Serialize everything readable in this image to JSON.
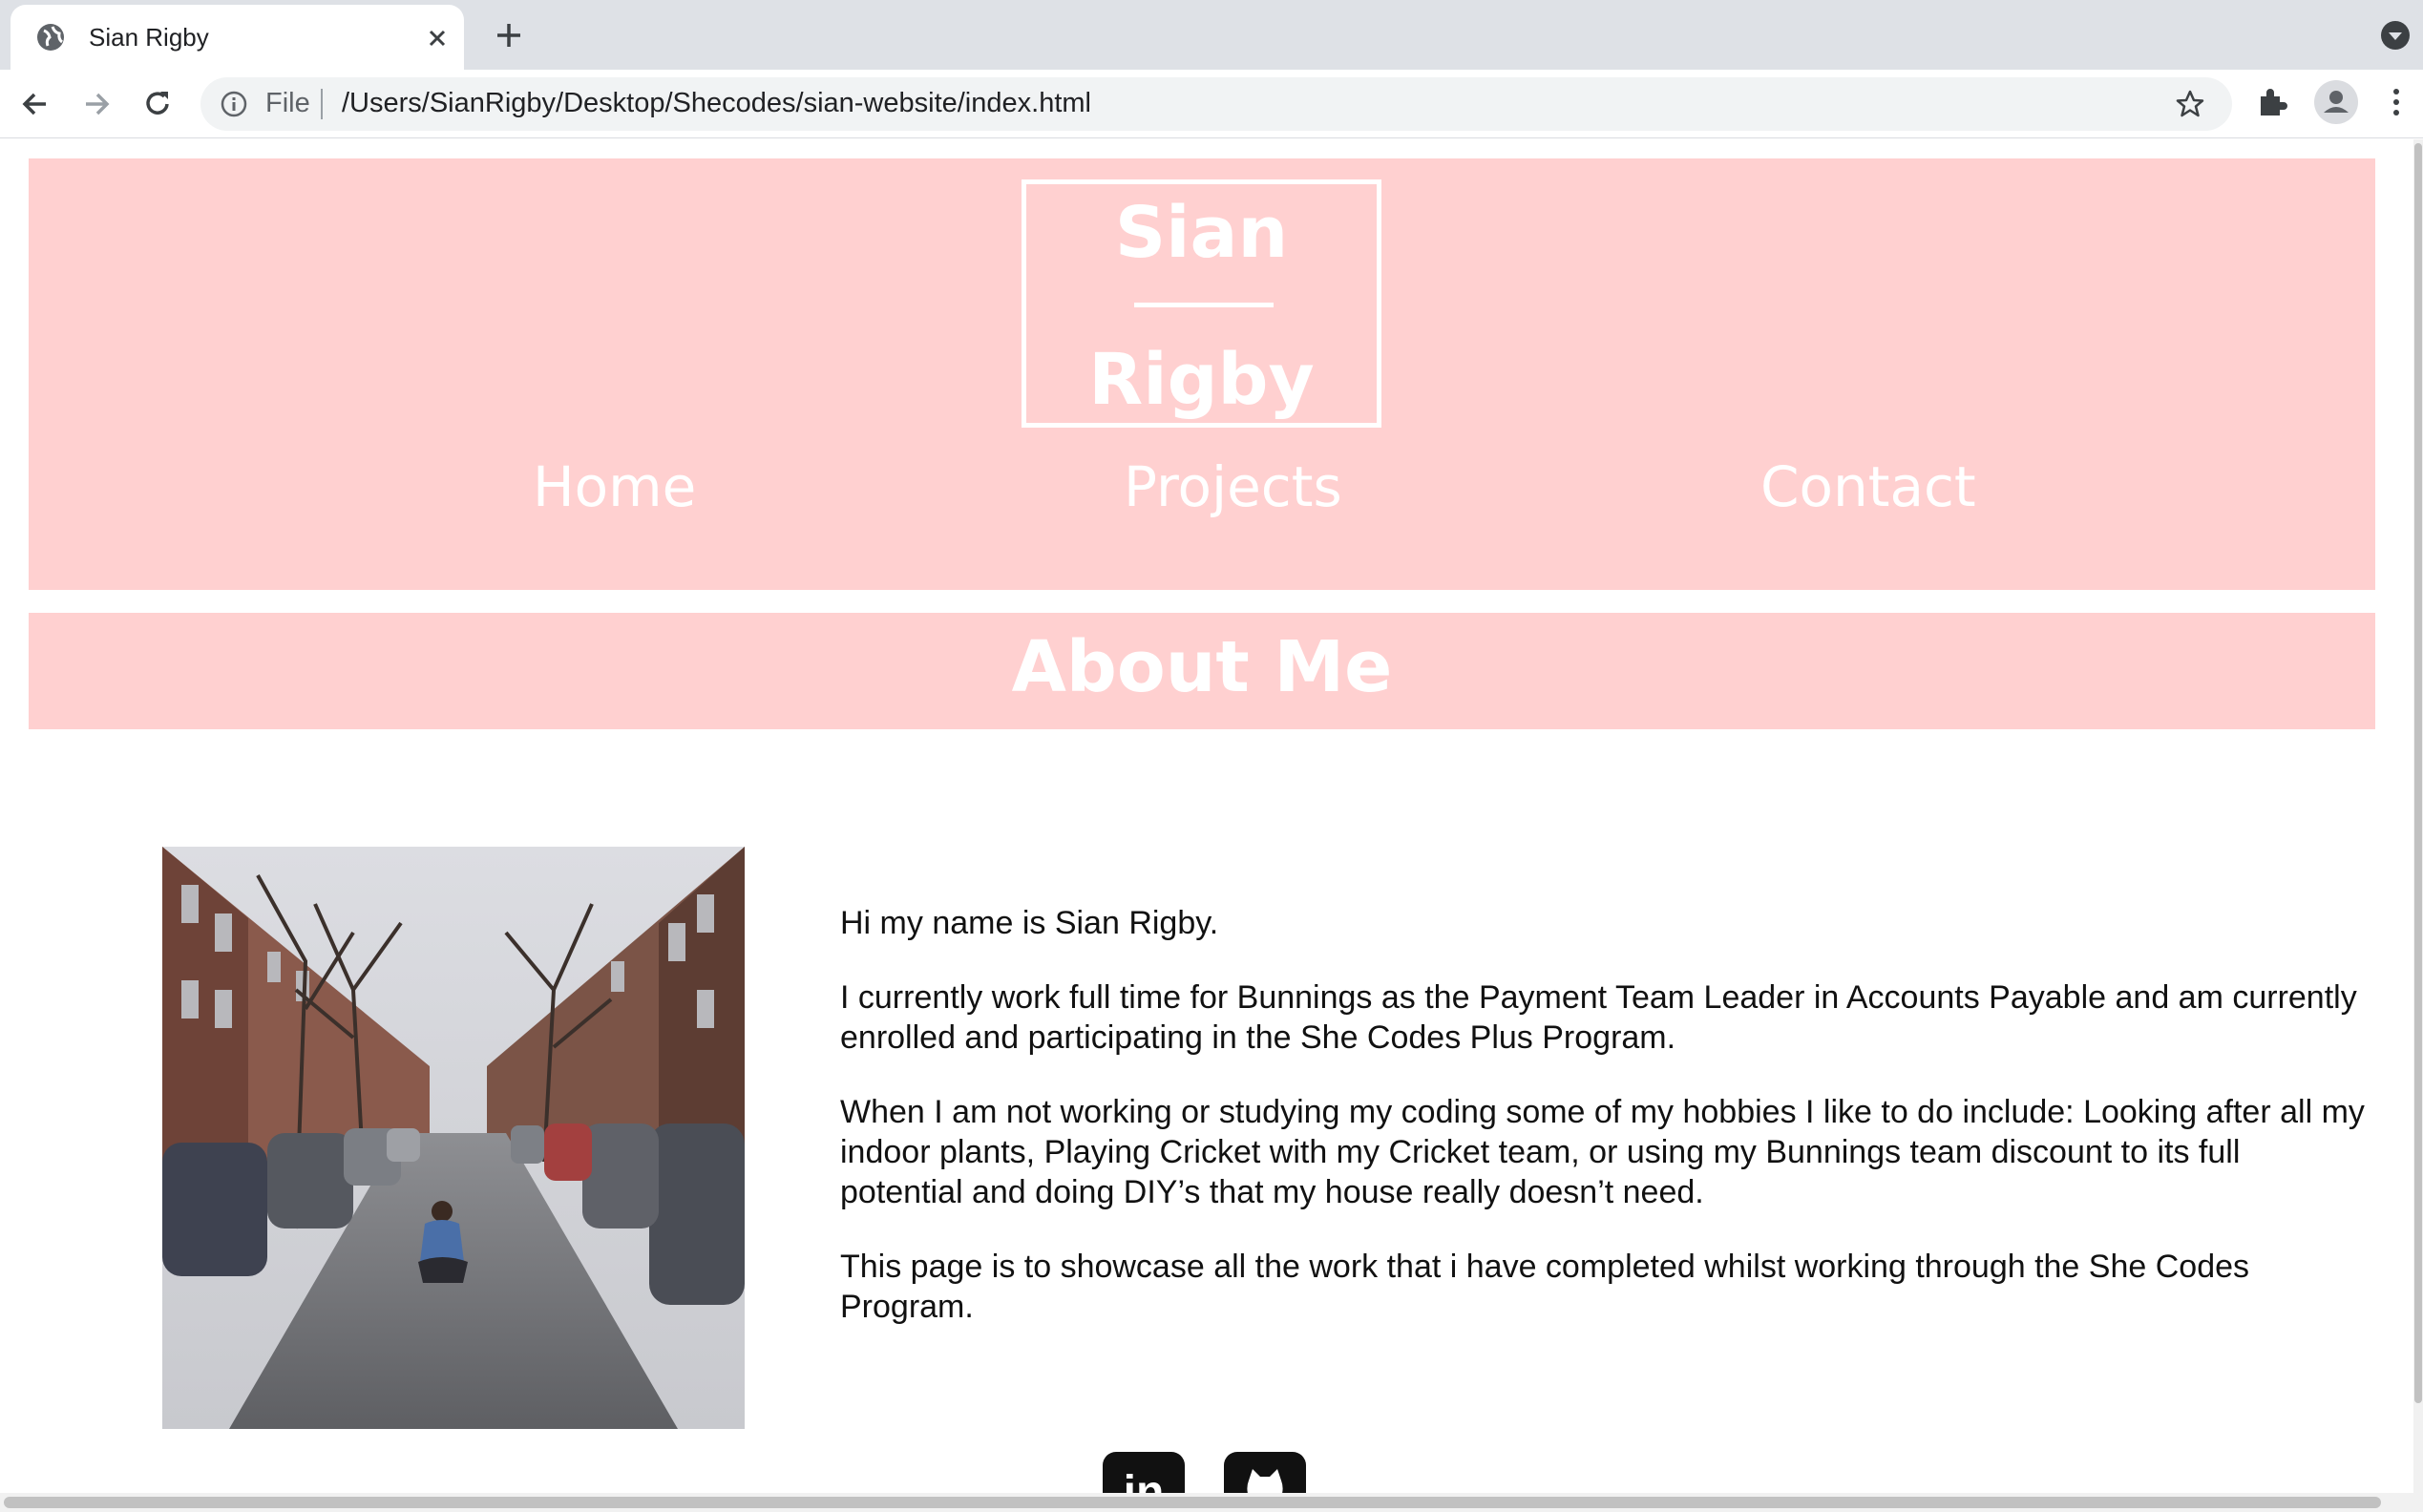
{
  "browser": {
    "tab_title": "Sian Rigby",
    "url_scheme": "File",
    "url": "/Users/SianRigby/Desktop/Shecodes/sian-website/index.html",
    "icons": [
      "globe-icon",
      "close-icon",
      "plus-icon",
      "chevron-down-icon",
      "back-icon",
      "forward-icon",
      "reload-icon",
      "info-icon",
      "star-icon",
      "puzzle-icon",
      "profile-icon",
      "more-vert-icon"
    ]
  },
  "site": {
    "logo_first": "Sian",
    "logo_last": "Rigby",
    "nav": [
      "Home",
      "Projects",
      "Contact"
    ],
    "about_title": "About Me",
    "bio": [
      "Hi my name is Sian Rigby.",
      "I currently work full time for Bunnings as the Payment Team Leader in Accounts Payable and am currently enrolled and participating in the She Codes Plus Program.",
      "When I am not working or studying my coding some of my hobbies I like to do include: Looking after all my indoor plants, Playing Cricket with my Cricket team, or using my Bunnings team discount to its full potential and doing DIY’s that my house really doesn’t need.",
      "This page is to showcase all the work that i have completed whilst working through the She Codes Program."
    ],
    "social": [
      {
        "label": "in",
        "icon": "linkedin-icon"
      },
      {
        "label": "",
        "icon": "github-icon"
      }
    ],
    "colors": {
      "header_bg": "#ffd0d0",
      "text": "#111111",
      "header_text": "#ffffff"
    }
  }
}
